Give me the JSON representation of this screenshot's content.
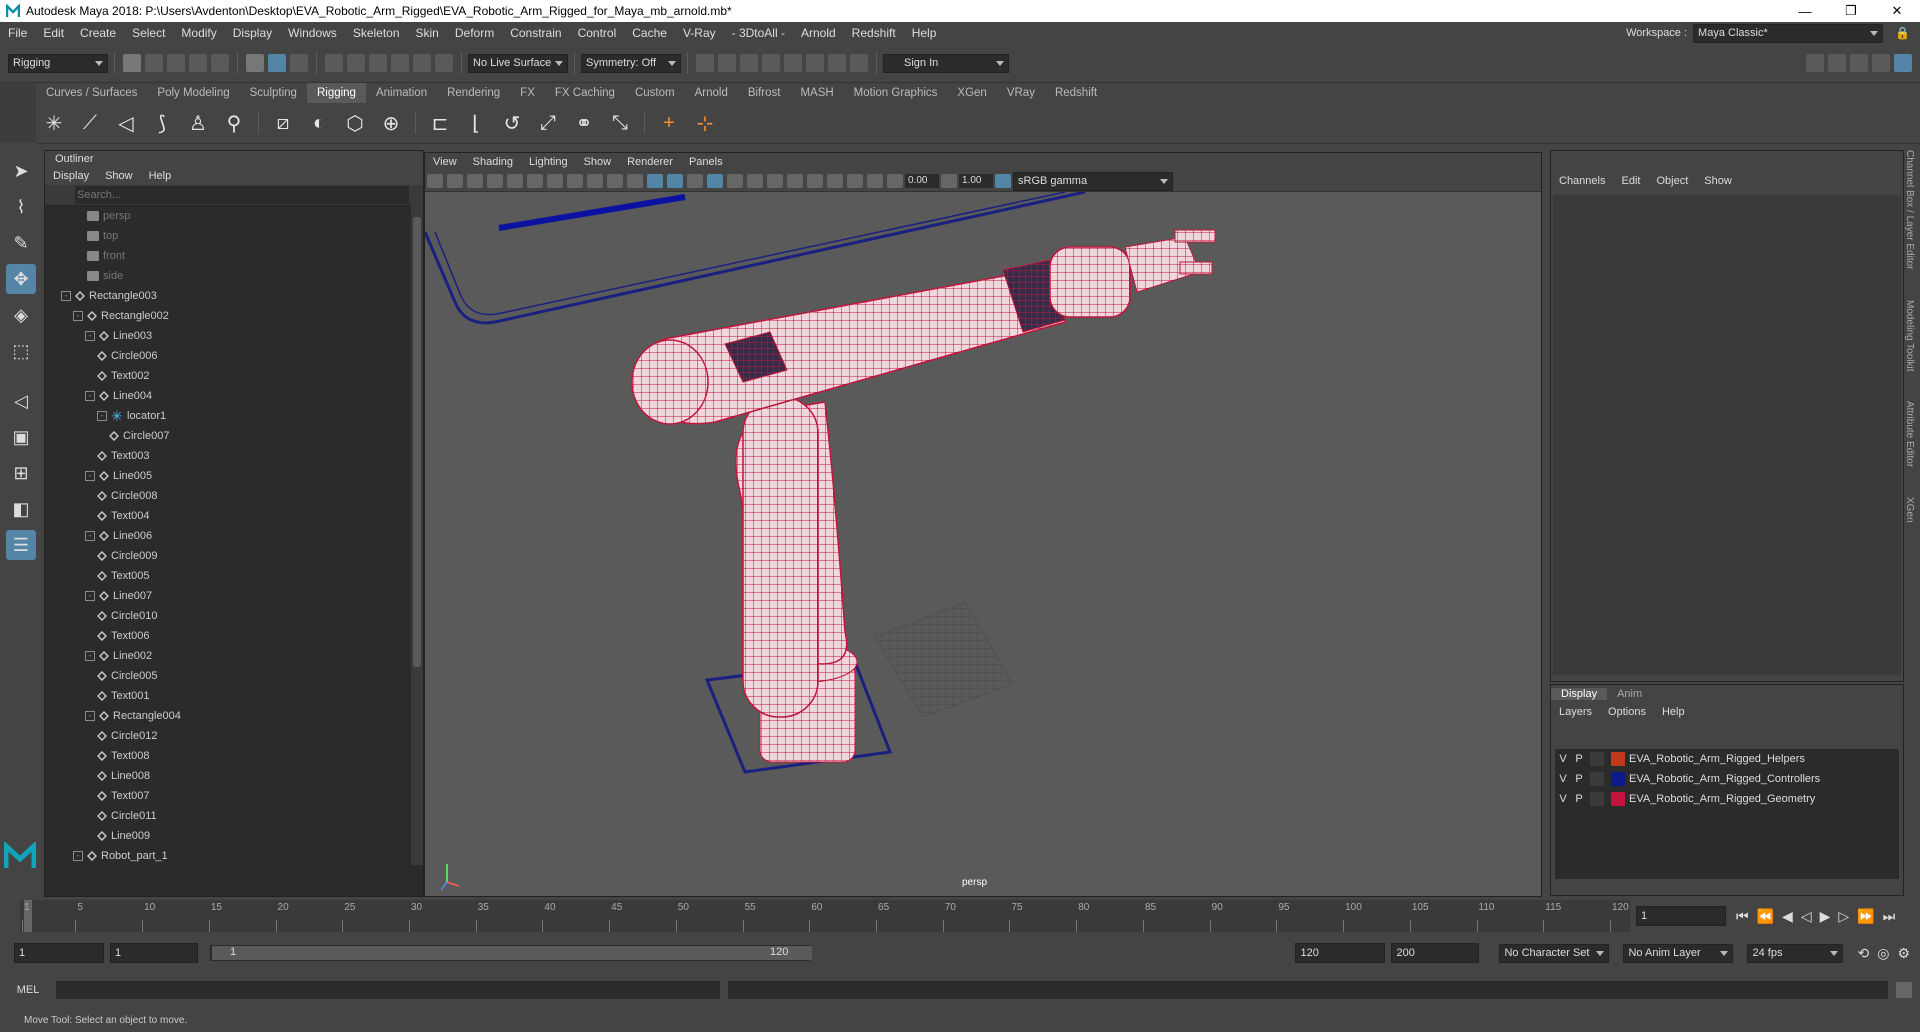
{
  "window": {
    "title": "Autodesk Maya 2018: P:\\Users\\Avdenton\\Desktop\\EVA_Robotic_Arm_Rigged\\EVA_Robotic_Arm_Rigged_for_Maya_mb_arnold.mb*",
    "min": "—",
    "max": "❐",
    "close": "✕"
  },
  "menubar": {
    "items": [
      "File",
      "Edit",
      "Create",
      "Select",
      "Modify",
      "Display",
      "Windows",
      "Skeleton",
      "Skin",
      "Deform",
      "Constrain",
      "Control",
      "Cache",
      "V-Ray",
      "- 3DtoAll -",
      "Arnold",
      "Redshift",
      "Help"
    ],
    "workspace_label": "Workspace :",
    "workspace_value": "Maya Classic*"
  },
  "status": {
    "mode": "Rigging",
    "live_surface": "No Live Surface",
    "symmetry": "Symmetry: Off",
    "sign_in": "Sign In"
  },
  "shelf_tabs": [
    "Curves / Surfaces",
    "Poly Modeling",
    "Sculpting",
    "Rigging",
    "Animation",
    "Rendering",
    "FX",
    "FX Caching",
    "Custom",
    "Arnold",
    "Bifrost",
    "MASH",
    "Motion Graphics",
    "XGen",
    "VRay",
    "Redshift"
  ],
  "shelf_active": "Rigging",
  "outliner": {
    "title": "Outliner",
    "menu": [
      "Display",
      "Show",
      "Help"
    ],
    "search_placeholder": "Search...",
    "rows": [
      {
        "label": "persp",
        "depth": 0,
        "icon": "camera",
        "dim": true,
        "expander": ""
      },
      {
        "label": "top",
        "depth": 0,
        "icon": "camera",
        "dim": true,
        "expander": ""
      },
      {
        "label": "front",
        "depth": 0,
        "icon": "camera",
        "dim": true,
        "expander": ""
      },
      {
        "label": "side",
        "depth": 0,
        "icon": "camera",
        "dim": true,
        "expander": ""
      },
      {
        "label": "Rectangle003",
        "depth": 0,
        "icon": "transform",
        "expander": "-"
      },
      {
        "label": "Rectangle002",
        "depth": 1,
        "icon": "transform",
        "expander": "-"
      },
      {
        "label": "Line003",
        "depth": 2,
        "icon": "transform",
        "expander": "-"
      },
      {
        "label": "Circle006",
        "depth": 3,
        "icon": "transform",
        "expander": ""
      },
      {
        "label": "Text002",
        "depth": 3,
        "icon": "transform",
        "expander": ""
      },
      {
        "label": "Line004",
        "depth": 2,
        "icon": "transform",
        "expander": "-"
      },
      {
        "label": "locator1",
        "depth": 3,
        "icon": "locator",
        "expander": "-"
      },
      {
        "label": "Circle007",
        "depth": 4,
        "icon": "transform",
        "expander": ""
      },
      {
        "label": "Text003",
        "depth": 3,
        "icon": "transform",
        "expander": ""
      },
      {
        "label": "Line005",
        "depth": 2,
        "icon": "transform",
        "expander": "-"
      },
      {
        "label": "Circle008",
        "depth": 3,
        "icon": "transform",
        "expander": ""
      },
      {
        "label": "Text004",
        "depth": 3,
        "icon": "transform",
        "expander": ""
      },
      {
        "label": "Line006",
        "depth": 2,
        "icon": "transform",
        "expander": "-"
      },
      {
        "label": "Circle009",
        "depth": 3,
        "icon": "transform",
        "expander": ""
      },
      {
        "label": "Text005",
        "depth": 3,
        "icon": "transform",
        "expander": ""
      },
      {
        "label": "Line007",
        "depth": 2,
        "icon": "transform",
        "expander": "-"
      },
      {
        "label": "Circle010",
        "depth": 3,
        "icon": "transform",
        "expander": ""
      },
      {
        "label": "Text006",
        "depth": 3,
        "icon": "transform",
        "expander": ""
      },
      {
        "label": "Line002",
        "depth": 2,
        "icon": "transform",
        "expander": "-"
      },
      {
        "label": "Circle005",
        "depth": 3,
        "icon": "transform",
        "expander": ""
      },
      {
        "label": "Text001",
        "depth": 3,
        "icon": "transform",
        "expander": ""
      },
      {
        "label": "Rectangle004",
        "depth": 2,
        "icon": "transform",
        "expander": "-"
      },
      {
        "label": "Circle012",
        "depth": 3,
        "icon": "transform",
        "expander": ""
      },
      {
        "label": "Text008",
        "depth": 3,
        "icon": "transform",
        "expander": ""
      },
      {
        "label": "Line008",
        "depth": 3,
        "icon": "transform",
        "expander": ""
      },
      {
        "label": "Text007",
        "depth": 3,
        "icon": "transform",
        "expander": ""
      },
      {
        "label": "Circle011",
        "depth": 3,
        "icon": "transform",
        "expander": ""
      },
      {
        "label": "Line009",
        "depth": 3,
        "icon": "transform",
        "expander": ""
      },
      {
        "label": "Robot_part_1",
        "depth": 1,
        "icon": "transform",
        "expander": "-"
      }
    ]
  },
  "viewport": {
    "menu": [
      "View",
      "Shading",
      "Lighting",
      "Show",
      "Renderer",
      "Panels"
    ],
    "exposure": "0.00",
    "gamma": "1.00",
    "color_space": "sRGB gamma",
    "camera_label": "persp"
  },
  "channelbox": {
    "menu": [
      "Channels",
      "Edit",
      "Object",
      "Show"
    ]
  },
  "layer_editor": {
    "tabs": [
      "Display",
      "Anim"
    ],
    "active_tab": "Display",
    "menu": [
      "Layers",
      "Options",
      "Help"
    ],
    "layers": [
      {
        "v": "V",
        "p": "P",
        "name": "EVA_Robotic_Arm_Rigged_Helpers",
        "color": "#c0391b"
      },
      {
        "v": "V",
        "p": "P",
        "name": "EVA_Robotic_Arm_Rigged_Controllers",
        "color": "#0d1a8a"
      },
      {
        "v": "V",
        "p": "P",
        "name": "EVA_Robotic_Arm_Rigged_Geometry",
        "color": "#c0143c"
      }
    ]
  },
  "side_tabs": [
    "Channel Box / Layer Editor",
    "Modeling Toolkit",
    "Attribute Editor",
    "XGen"
  ],
  "timeline": {
    "ticks": [
      "1",
      "5",
      "10",
      "15",
      "20",
      "25",
      "30",
      "35",
      "40",
      "45",
      "50",
      "55",
      "60",
      "65",
      "70",
      "75",
      "80",
      "85",
      "90",
      "95",
      "100",
      "105",
      "110",
      "115",
      "120"
    ],
    "current_frame": "1"
  },
  "range": {
    "start": "1",
    "playback_start": "1",
    "slider_start": "1",
    "slider_end": "120",
    "playback_end": "120",
    "end": "200",
    "character_set": "No Character Set",
    "anim_layer": "No Anim Layer",
    "fps": "24 fps"
  },
  "cmdline": {
    "label": "MEL"
  },
  "helpline": {
    "text": "Move Tool: Select an object to move."
  }
}
